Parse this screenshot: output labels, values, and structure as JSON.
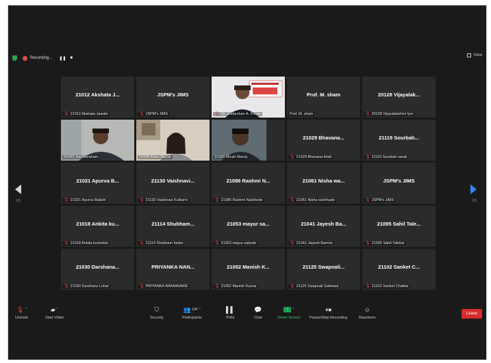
{
  "topbar": {
    "recording_label": "Recording...",
    "pause_glyph": "❚❚",
    "stop_glyph": "■",
    "view_label": "View"
  },
  "pager": {
    "left": "1/5",
    "right": "1/5"
  },
  "tiles": [
    {
      "big": "21012 Akshata J...",
      "label": "21012 Akshata Jawale",
      "muted": true
    },
    {
      "big": "JSPM's JIMS",
      "label": "JSPM's JIMS",
      "muted": true
    },
    {
      "big": "",
      "label": "Dr. Sudarshan A. Pawar",
      "muted": true,
      "video": "presenter"
    },
    {
      "big": "Prof. M. sham",
      "label": "Prof. M. sham",
      "muted": false
    },
    {
      "big": "20128 Vijayalak...",
      "label": "20128 Vijayalakshmi Iyer",
      "muted": true
    },
    {
      "big": "",
      "label": "21043 Joel Abraham",
      "muted": false,
      "video": "joel",
      "active": true
    },
    {
      "big": "",
      "label": "21048 Kiran Nayak",
      "muted": false,
      "video": "kiran"
    },
    {
      "big": "",
      "label": "21055 Micah Manoj",
      "muted": false,
      "video": "micah"
    },
    {
      "big": "21029 Bhavana...",
      "label": "21029 Bhavana khati",
      "muted": true
    },
    {
      "big": "21119 Sourbah...",
      "label": "21119 Sourbah sarak",
      "muted": true
    },
    {
      "big": "21021 Apurva B...",
      "label": "21021 Apurva Bakshi",
      "muted": true
    },
    {
      "big": "21130 Vaishnavi...",
      "label": "21130 Vaishnavi Kulkarni",
      "muted": true
    },
    {
      "big": "21086 Rashmi N...",
      "label": "21086 Rashmi Narkhede",
      "muted": true
    },
    {
      "big": "21061 Nisha wa...",
      "label": "21061 Nisha warkhade",
      "muted": true
    },
    {
      "big": "JSPM's JIMS",
      "label": "JSPM's JIMS",
      "muted": true
    },
    {
      "big": "21018 Ankita ku...",
      "label": "21018 Ankita kuchekar",
      "muted": true
    },
    {
      "big": "21114 Shubham...",
      "label": "21114 Shubham kedar",
      "muted": true
    },
    {
      "big": "21053 mayur sa...",
      "label": "21053 mayur satpute",
      "muted": true
    },
    {
      "big": "21041 Jayesh Ba...",
      "label": "21041 Jayesh Bamne",
      "muted": true
    },
    {
      "big": "21095 Sahil Tale...",
      "label": "21095 Sahil Talekar",
      "muted": true
    },
    {
      "big": "21030 Darshana...",
      "label": "21030 Darshana Lohar",
      "muted": true
    },
    {
      "big": "PRIYANKA NAN...",
      "label": "PRIYANKA NANNAVARE",
      "muted": true
    },
    {
      "big": "21052 Manish K...",
      "label": "21052 Manish Kumar",
      "muted": true
    },
    {
      "big": "21125 Swapnali...",
      "label": "21125 Swapnali Gaikwad",
      "muted": true
    },
    {
      "big": "21102 Sanket C...",
      "label": "21102 Sanket Chafale",
      "muted": true
    }
  ],
  "toolbar": {
    "unmute": "Unmute",
    "start_video": "Start Video",
    "security": "Security",
    "participants": "Participants",
    "participants_count": "104",
    "polls": "Polls",
    "chat": "Chat",
    "share_screen": "Share Screen",
    "pause_stop_recording": "Pause/Stop Recording",
    "reactions": "Reactions",
    "leave": "Leave"
  },
  "colors": {
    "accent_blue": "#2c8cf4",
    "share_green": "#1f9d55",
    "leave_red": "#d62c2c",
    "active_speaker": "#c8d26a"
  }
}
